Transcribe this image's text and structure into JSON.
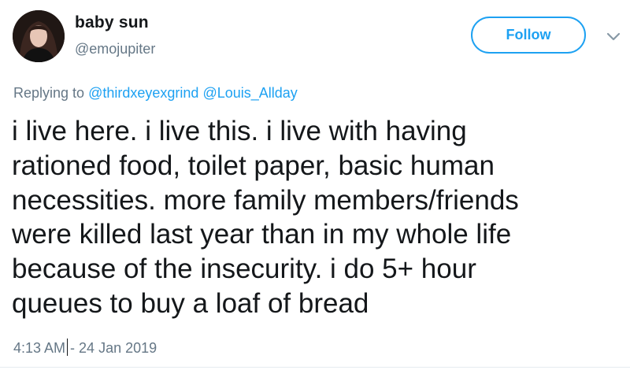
{
  "user": {
    "display_name": "baby sun",
    "handle": "@emojupiter"
  },
  "actions": {
    "follow_label": "Follow",
    "more_icon": "chevron-down-icon"
  },
  "reply": {
    "prefix": "Replying to",
    "mentions": [
      "@thirdxeyexgrind",
      "@Louis_Allday"
    ]
  },
  "tweet": {
    "lines": [
      "i live here. i live this. i live with having",
      "rationed food, toilet paper, basic human",
      "necessities. more family members/friends",
      "were killed last year than in my whole life",
      "because of the insecurity. i do 5+ hour",
      "queues to buy a loaf of bread"
    ]
  },
  "meta": {
    "time": "4:13 AM",
    "separator": "- 24 Jan 2019"
  },
  "colors": {
    "accent": "#1da1f2",
    "secondary_text": "#657786",
    "primary_text": "#14171a"
  }
}
